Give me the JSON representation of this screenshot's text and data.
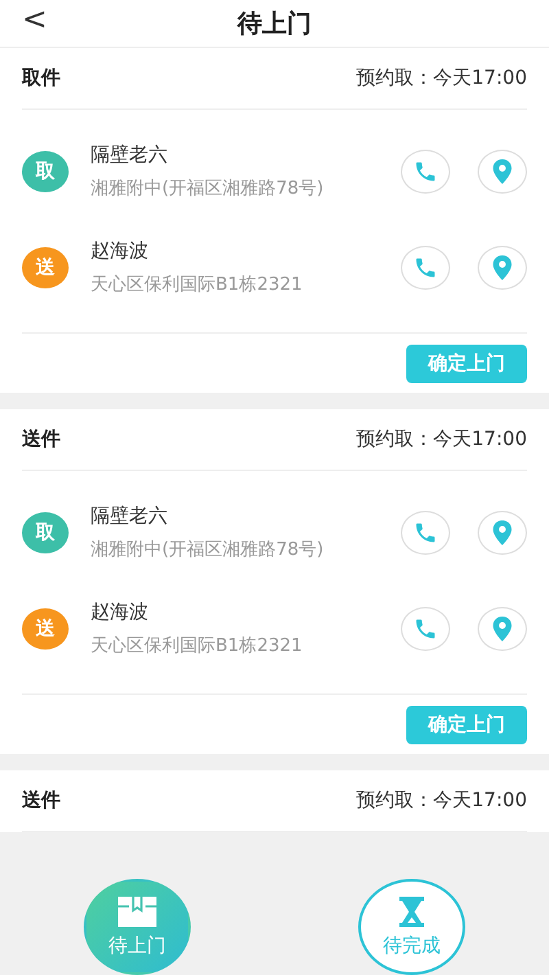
{
  "header": {
    "back": "<",
    "title": "待上门"
  },
  "orders": [
    {
      "type": "取件",
      "appointment": "预约取：今天17:00",
      "contacts": [
        {
          "badge": "取",
          "color": "#3dbfa8",
          "name": "隔壁老六",
          "address": "湘雅附中(开福区湘雅路78号)"
        },
        {
          "badge": "送",
          "color": "#f7961e",
          "name": "赵海波",
          "address": "天心区保利国际B1栋2321"
        }
      ],
      "button": "确定上门"
    },
    {
      "type": "送件",
      "appointment": "预约取：今天17:00",
      "contacts": [
        {
          "badge": "取",
          "color": "#3dbfa8",
          "name": "隔壁老六",
          "address": "湘雅附中(开福区湘雅路78号)"
        },
        {
          "badge": "送",
          "color": "#f7961e",
          "name": "赵海波",
          "address": "天心区保利国际B1栋2321"
        }
      ],
      "button": "确定上门"
    },
    {
      "type": "送件",
      "appointment": "预约取：今天17:00"
    }
  ],
  "tabs": [
    {
      "label": "待上门",
      "kind": "box",
      "selected": true
    },
    {
      "label": "待完成",
      "kind": "hourglass",
      "selected": false
    }
  ]
}
